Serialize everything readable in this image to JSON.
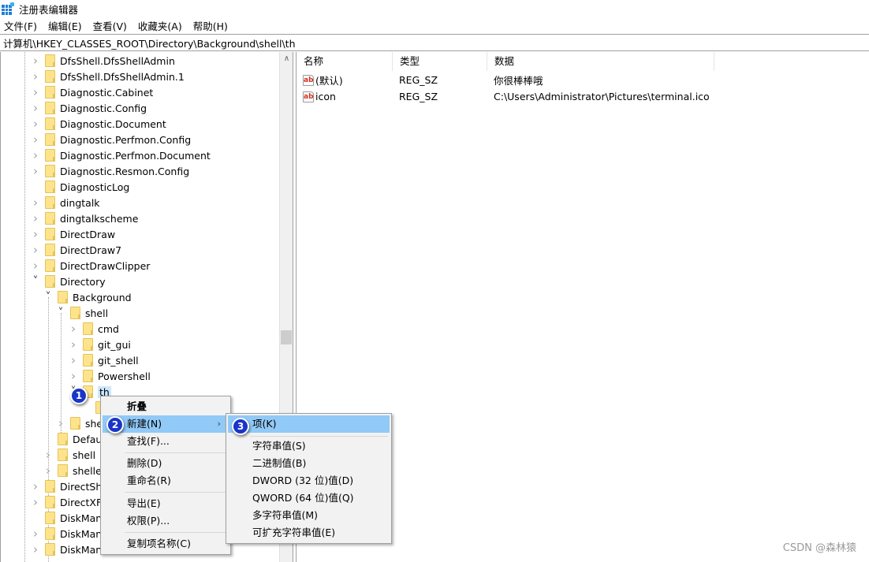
{
  "window": {
    "title": "注册表编辑器",
    "icon": "regedit-icon"
  },
  "menubar": {
    "items": [
      "文件(F)",
      "编辑(E)",
      "查看(V)",
      "收藏夹(A)",
      "帮助(H)"
    ]
  },
  "address": {
    "path": "计算机\\HKEY_CLASSES_ROOT\\Directory\\Background\\shell\\th"
  },
  "tree": {
    "items": [
      {
        "label": "DfsShell.DfsShellAdmin",
        "level": 0,
        "expander": "collapsed"
      },
      {
        "label": "DfsShell.DfsShellAdmin.1",
        "level": 0,
        "expander": "collapsed"
      },
      {
        "label": "Diagnostic.Cabinet",
        "level": 0,
        "expander": "collapsed"
      },
      {
        "label": "Diagnostic.Config",
        "level": 0,
        "expander": "collapsed"
      },
      {
        "label": "Diagnostic.Document",
        "level": 0,
        "expander": "collapsed"
      },
      {
        "label": "Diagnostic.Perfmon.Config",
        "level": 0,
        "expander": "collapsed"
      },
      {
        "label": "Diagnostic.Perfmon.Document",
        "level": 0,
        "expander": "collapsed"
      },
      {
        "label": "Diagnostic.Resmon.Config",
        "level": 0,
        "expander": "collapsed"
      },
      {
        "label": "DiagnosticLog",
        "level": 0,
        "expander": "none"
      },
      {
        "label": "dingtalk",
        "level": 0,
        "expander": "collapsed"
      },
      {
        "label": "dingtalkscheme",
        "level": 0,
        "expander": "collapsed"
      },
      {
        "label": "DirectDraw",
        "level": 0,
        "expander": "collapsed"
      },
      {
        "label": "DirectDraw7",
        "level": 0,
        "expander": "collapsed"
      },
      {
        "label": "DirectDrawClipper",
        "level": 0,
        "expander": "collapsed"
      },
      {
        "label": "Directory",
        "level": 0,
        "expander": "expanded"
      },
      {
        "label": "Background",
        "level": 1,
        "expander": "expanded"
      },
      {
        "label": "shell",
        "level": 2,
        "expander": "expanded"
      },
      {
        "label": "cmd",
        "level": 3,
        "expander": "collapsed"
      },
      {
        "label": "git_gui",
        "level": 3,
        "expander": "collapsed"
      },
      {
        "label": "git_shell",
        "level": 3,
        "expander": "collapsed"
      },
      {
        "label": "Powershell",
        "level": 3,
        "expander": "collapsed"
      },
      {
        "label": "th",
        "level": 3,
        "expander": "expanded",
        "selected": true
      },
      {
        "label": "",
        "level": 4,
        "expander": "none"
      },
      {
        "label": "she",
        "level": 2,
        "expander": "collapsed"
      },
      {
        "label": "Defaul",
        "level": 1,
        "expander": "none"
      },
      {
        "label": "shell",
        "level": 1,
        "expander": "collapsed"
      },
      {
        "label": "shellex",
        "level": 1,
        "expander": "collapsed"
      },
      {
        "label": "DirectSho",
        "level": 0,
        "expander": "collapsed"
      },
      {
        "label": "DirectXFi",
        "level": 0,
        "expander": "collapsed"
      },
      {
        "label": "DiskMan",
        "level": 0,
        "expander": "none"
      },
      {
        "label": "DiskMan",
        "level": 0,
        "expander": "collapsed"
      },
      {
        "label": "DiskMan",
        "level": 0,
        "expander": "collapsed"
      }
    ]
  },
  "list": {
    "columns": [
      "名称",
      "类型",
      "数据"
    ],
    "rows": [
      {
        "name": "(默认)",
        "type": "REG_SZ",
        "data": "你很棒棒哦",
        "icon": "ab"
      },
      {
        "name": "icon",
        "type": "REG_SZ",
        "data": "C:\\Users\\Administrator\\Pictures\\terminal.ico",
        "icon": "ab"
      }
    ]
  },
  "context_menu": {
    "items": [
      {
        "label": "折叠",
        "bold": true
      },
      {
        "label": "新建(N)",
        "submenu": true,
        "highlighted": true
      },
      {
        "label": "查找(F)..."
      },
      {
        "separator": true
      },
      {
        "label": "删除(D)"
      },
      {
        "label": "重命名(R)"
      },
      {
        "separator": true
      },
      {
        "label": "导出(E)"
      },
      {
        "label": "权限(P)..."
      },
      {
        "separator": true
      },
      {
        "label": "复制项名称(C)"
      }
    ]
  },
  "submenu": {
    "items": [
      {
        "label": "项(K)",
        "highlighted": true
      },
      {
        "separator": true
      },
      {
        "label": "字符串值(S)"
      },
      {
        "label": "二进制值(B)"
      },
      {
        "label": "DWORD (32 位)值(D)"
      },
      {
        "label": "QWORD (64 位)值(Q)"
      },
      {
        "label": "多字符串值(M)"
      },
      {
        "label": "可扩充字符串值(E)"
      }
    ]
  },
  "annotations": {
    "steps": [
      "1",
      "2",
      "3"
    ],
    "color": "#1a35c8"
  },
  "watermark": "CSDN @森林猿",
  "colors": {
    "highlight": "#91c9f7",
    "selection": "#cce8ff",
    "folder": "#fde48c"
  }
}
